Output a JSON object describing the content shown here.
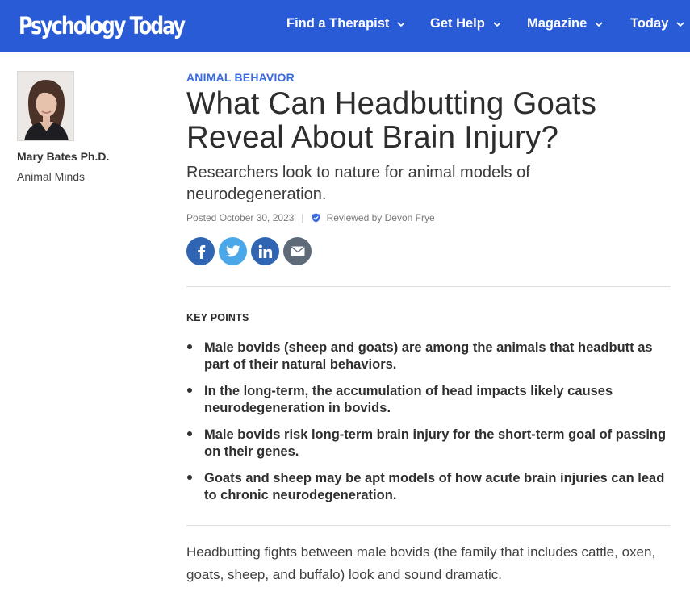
{
  "header": {
    "logo": "Psychology Today",
    "nav": [
      {
        "label": "Find a Therapist"
      },
      {
        "label": "Get Help"
      },
      {
        "label": "Magazine"
      },
      {
        "label": "Today"
      }
    ],
    "color": "#2a5bd7"
  },
  "author": {
    "name": "Mary Bates Ph.D.",
    "blog": "Animal Minds"
  },
  "article": {
    "category": "ANIMAL BEHAVIOR",
    "title": "What Can Headbutting Goats Reveal About Brain Injury?",
    "subtitle": "Researchers look to nature for animal models of neurodegeneration.",
    "posted": "Posted October 30, 2023",
    "separator": "|",
    "reviewed": "Reviewed by Devon Frye",
    "share": [
      "facebook-icon",
      "twitter-icon",
      "linkedin-icon",
      "email-icon"
    ],
    "key_points_heading": "KEY POINTS",
    "key_points": [
      "Male bovids (sheep and goats) are among the animals that headbutt as part of their natural behaviors.",
      "In the long-term, the accumulation of head impacts likely causes neurodegeneration in bovids.",
      "Male bovids risk long-term brain injury for the short-term goal of passing on their genes.",
      "Goats and sheep may be apt models of how acute brain injuries can lead to chronic neurodegeneration."
    ],
    "body": "Headbutting fights between male bovids (the family that includes cattle, oxen, goats, sheep, and buffalo) look and sound dramatic."
  },
  "colors": {
    "accent": "#3a6ae0",
    "facebook": "#2f65b3",
    "twitter": "#4aa8e8",
    "linkedin": "#2f65b3",
    "email": "#5e6a78"
  }
}
